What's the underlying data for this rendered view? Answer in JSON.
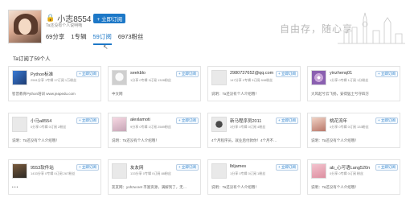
{
  "profile": {
    "username": "小志8554",
    "follow_label": "+ 立即订阅",
    "subtitle": "Ta还没有个人说明哦",
    "stats": [
      "69分享",
      "1专辑",
      "59订阅",
      "6973粉丝"
    ],
    "active_stat_index": 2
  },
  "slogan": "自由存，随心享",
  "subscription_count": "Ta订阅了59个人",
  "cards": [
    {
      "name": "Python标准",
      "counts": "2561分享  1专辑  17订阅  1万粉丝",
      "follow": "+ 立即订阅",
      "desc": "智普教育Python培训  www.jeapedu.com",
      "avatar": "python"
    },
    {
      "name": "seekblo",
      "counts": "1分享  0专辑  3订阅  1328粉丝",
      "follow": "+ 立即订阅",
      "desc": "中文网",
      "avatar": "cat"
    },
    {
      "name": "2980737652@qq.com",
      "counts": "147分享  0专辑  3订阅  848粉丝",
      "follow": "+ 立即订阅",
      "desc": "说明：Ta还没有个人介绍哦！",
      "avatar": "blank"
    },
    {
      "name": "yinzhenq01",
      "counts": "1分享  0专辑  1订阅  1分粉丝",
      "follow": "+ 立即订阅",
      "desc": "大风起兮云飞扬，安得猛士兮守四方",
      "avatar": "cd"
    },
    {
      "name": "小马a8554",
      "counts": "0分享  0专辑  0订阅  2粉丝",
      "follow": "+ 立即订阅",
      "desc": "说明：Ta还没有个人介绍哦！",
      "avatar": "blank"
    },
    {
      "name": "alexlamoti",
      "counts": "9分享  0专辑  1订阅  2589粉丝",
      "follow": "+ 立即订阅",
      "desc": "说明：Ta还没有个人介绍哦！",
      "avatar": "anime"
    },
    {
      "name": "新马程序员2011",
      "counts": "3分享  0专辑  0订阅  4粉丝",
      "follow": "+ 立即订阅",
      "desc": "4个月程序员，就业后付款你！4个月不…",
      "avatar": "logo"
    },
    {
      "name": "桃花流年",
      "counts": "4分享  0专辑  0订阅  133粉丝",
      "follow": "+ 立即订阅",
      "desc": "说明：Ta还没有个人介绍哦！",
      "avatar": "girl"
    },
    {
      "name": "9553软件站",
      "counts": "1433分享  0专辑  0订阅  267粉丝",
      "follow": "+ 立即订阅",
      "desc": "• • •",
      "avatar": "dark"
    },
    {
      "name": "友友网",
      "counts": "133分享  0专辑  0订阅  88粉丝",
      "follow": "+ 立即订阅",
      "desc": "友友网：yohzw.net 丰富资源，满解到了，无…",
      "avatar": "blank"
    },
    {
      "name": "lbljames",
      "counts": "1分享  0专辑  0订阅  1粉丝",
      "follow": "+ 立即订阅",
      "desc": "说明：Ta还没有个人介绍哦！",
      "avatar": "blank"
    },
    {
      "name": "ab_心可语Lang520n",
      "counts": "0分享  0专辑  0订阅  粉丝",
      "follow": "+ 立即订阅",
      "desc": "说明：Ta还没有个人介绍哦！",
      "avatar": "pink"
    }
  ]
}
